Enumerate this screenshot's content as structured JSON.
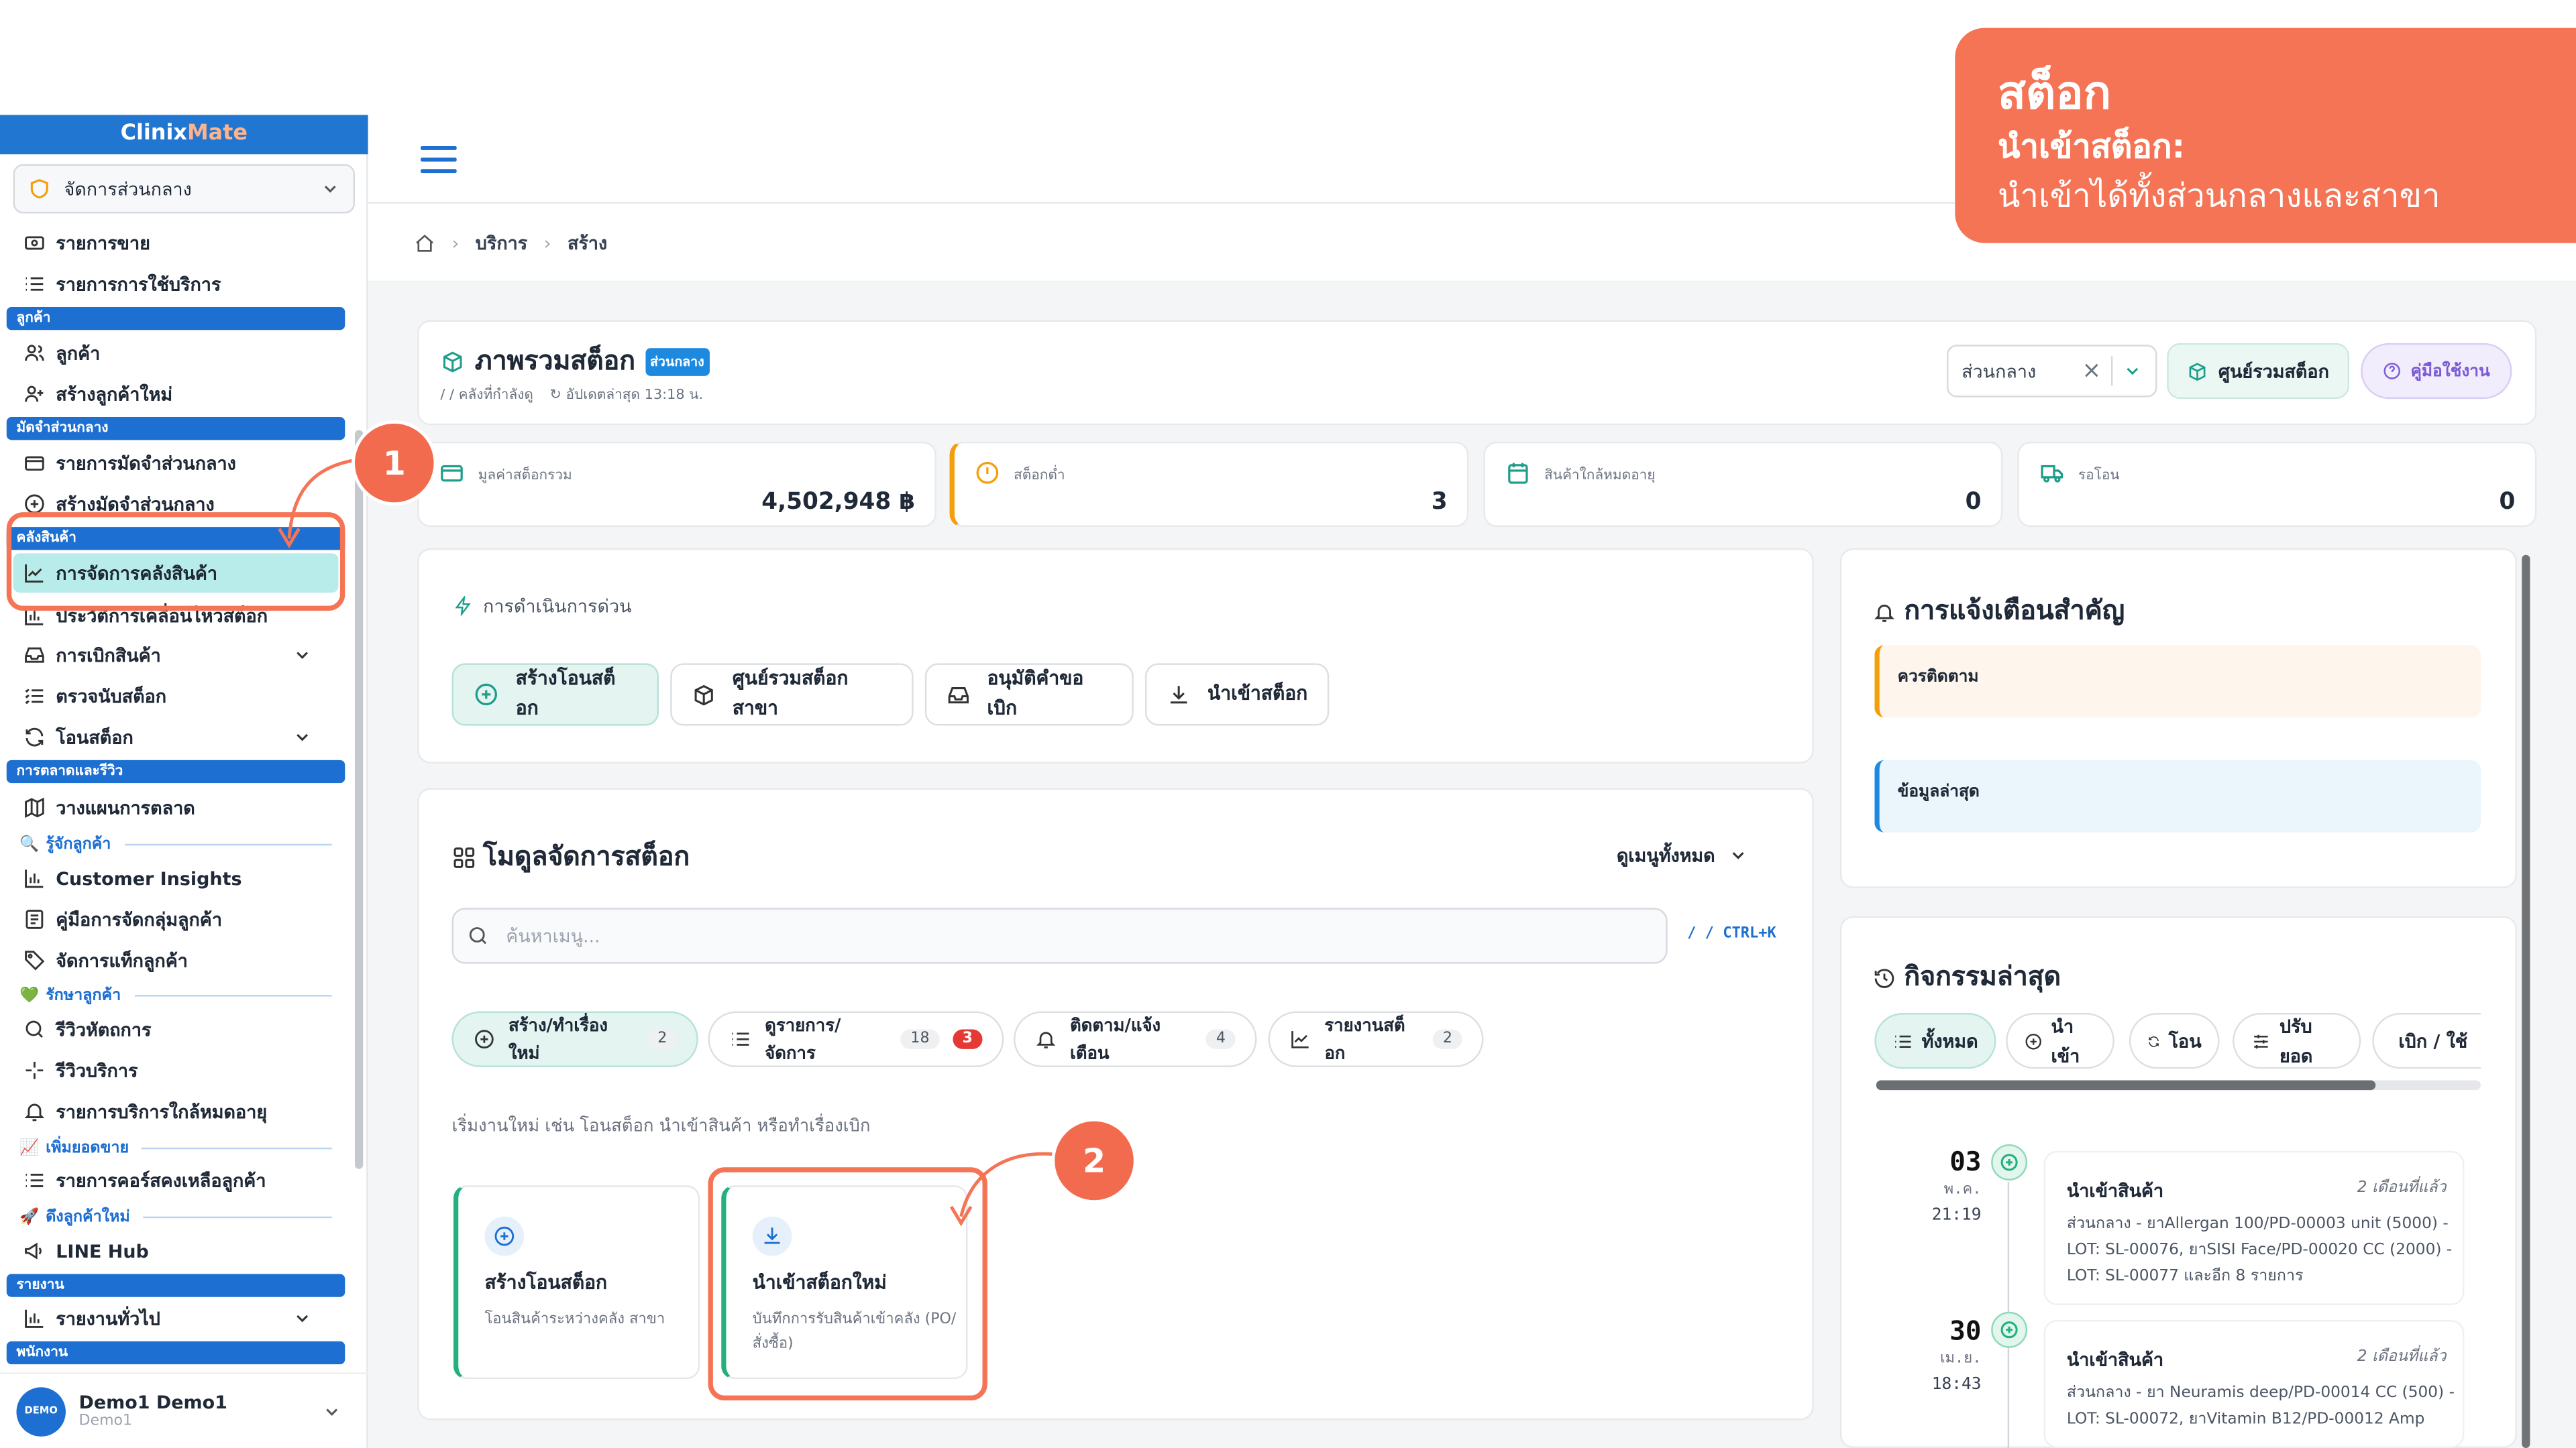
{
  "banner": {
    "title": "สต็อก",
    "subtitle": "นำเข้าสต็อก:",
    "desc": "นำเข้าได้ทั้งส่วนกลางและสาขา"
  },
  "sidebar": {
    "brand_a": "Clinix",
    "brand_b": "Mate",
    "branch": "จัดการส่วนกลาง",
    "items": [
      {
        "label": "รายการขาย",
        "icon": "receipt-icon"
      },
      {
        "label": "รายการการใช้บริการ",
        "icon": "list-icon"
      },
      {
        "label": "ลูกค้า",
        "icon": "users-icon"
      },
      {
        "label": "สร้างลูกค้าใหม่",
        "icon": "user-plus-icon"
      },
      {
        "label": "รายการมัดจำส่วนกลาง",
        "icon": "wallet-icon"
      },
      {
        "label": "สร้างมัดจำส่วนกลาง",
        "icon": "plus-circle-icon"
      },
      {
        "label": "การจัดการคลังสินค้า",
        "icon": "chart-line-icon"
      },
      {
        "label": "ประวัติการเคลื่อนไหวสต็อก",
        "icon": "bar-chart-icon"
      },
      {
        "label": "การเบิกสินค้า",
        "icon": "inbox-icon"
      },
      {
        "label": "ตรวจนับสต็อก",
        "icon": "list-check-icon"
      },
      {
        "label": "โอนสต็อก",
        "icon": "refresh-icon"
      },
      {
        "label": "วางแผนการตลาด",
        "icon": "map-icon"
      },
      {
        "label": "Customer Insights",
        "icon": "bar-chart-icon"
      },
      {
        "label": "คู่มือการจัดกลุ่มลูกค้า",
        "icon": "book-icon"
      },
      {
        "label": "จัดการแท็กลูกค้า",
        "icon": "tag-icon"
      },
      {
        "label": "รีวิวหัตถการ",
        "icon": "search-icon"
      },
      {
        "label": "รีวิวบริการ",
        "icon": "sparkle-icon"
      },
      {
        "label": "รายการบริการใกล้หมดอายุ",
        "icon": "bell-icon"
      },
      {
        "label": "รายการคอร์สคงเหลือลูกค้า",
        "icon": "list-icon"
      },
      {
        "label": "LINE Hub",
        "icon": "megaphone-icon"
      },
      {
        "label": "รายงานทั่วไป",
        "icon": "bar-chart-icon"
      }
    ],
    "sections": [
      "ลูกค้า",
      "มัดจำส่วนกลาง",
      "คลังสินค้า",
      "การตลาดและรีวิว",
      "รายงาน",
      "พนักงาน"
    ],
    "subsections": [
      "รู้จักลูกค้า",
      "รักษาลูกค้า",
      "เพิ่มยอดขาย",
      "ดึงลูกค้าใหม่"
    ],
    "user": {
      "avatar": "DEMO",
      "name": "Demo1 Demo1",
      "sub": "Demo1"
    }
  },
  "breadcrumb": [
    "บริการ",
    "สร้าง"
  ],
  "overview": {
    "title": "ภาพรวมสต็อก",
    "badge": "ส่วนกลาง",
    "sub1": "/ / คลังที่กำลังดู",
    "sub2": "อัปเดตล่าสุด 13:18 น.",
    "branch_select": "ส่วนกลาง",
    "center_btn": "ศูนย์รวมสต็อก",
    "guide_btn": "คู่มือใช้งาน"
  },
  "stats": [
    {
      "label": "มูลค่าสต็อกรวม",
      "value": "4,502,948 ฿"
    },
    {
      "label": "สต็อกต่ำ",
      "value": "3"
    },
    {
      "label": "สินค้าใกล้หมดอายุ",
      "value": "0"
    },
    {
      "label": "รอโอน",
      "value": "0"
    }
  ],
  "quick": {
    "title": "การดำเนินการด่วน",
    "buttons": [
      "สร้างโอนสต็อก",
      "ศูนย์รวมสต็อกสาขา",
      "อนุมัติคำขอเบิก",
      "นำเข้าสต็อก"
    ]
  },
  "module": {
    "title": "โมดูลจัดการสต็อก",
    "view_all": "ดูเมนูทั้งหมด",
    "search_placeholder": "ค้นหาเมนู...",
    "shortcut": "/ / CTRL+K",
    "tabs": [
      {
        "label": "สร้าง/ทำเรื่องใหม่",
        "count": "2"
      },
      {
        "label": "ดูรายการ/จัดการ",
        "count": "18",
        "alert": "3"
      },
      {
        "label": "ติดตาม/แจ้งเตือน",
        "count": "4"
      },
      {
        "label": "รายงานสต็อก",
        "count": "2"
      }
    ],
    "hint": "เริ่มงานใหม่ เช่น โอนสต็อก นำเข้าสินค้า หรือทำเรื่องเบิก",
    "tiles": [
      {
        "title": "สร้างโอนสต็อก",
        "desc": "โอนสินค้าระหว่างคลัง สาขา"
      },
      {
        "title": "นำเข้าสต็อกใหม่",
        "desc": "บันทึกการรับสินค้าเข้าคลัง (PO/สั่งซื้อ)"
      }
    ]
  },
  "alerts": {
    "title": "การแจ้งเตือนสำคัญ",
    "items": [
      "ควรติดตาม",
      "ข้อมูลล่าสุด"
    ]
  },
  "activity": {
    "title": "กิจกรรมล่าสุด",
    "tabs": [
      "ทั้งหมด",
      "นำเข้า",
      "โอน",
      "ปรับยอด",
      "เบิก / ใช้"
    ],
    "events": [
      {
        "day": "03",
        "month": "พ.ค.",
        "time": "21:19",
        "title": "นำเข้าสินค้า",
        "ago": "2 เดือนที่แล้ว",
        "body": "ส่วนกลาง - ยาAllergan 100/PD-00003 unit (5000) - LOT: SL-00076, ยาSISI Face/PD-00020 CC (2000) - LOT: SL-00077 และอีก 8 รายการ"
      },
      {
        "day": "30",
        "month": "เม.ย.",
        "time": "18:43",
        "title": "นำเข้าสินค้า",
        "ago": "2 เดือนที่แล้ว",
        "body": "ส่วนกลาง - ยา Neuramis deep/PD-00014 CC (500) - LOT: SL-00072, ยาVitamin B12/PD-00012 Amp"
      }
    ]
  },
  "annotations": [
    "1",
    "2"
  ],
  "colors": {
    "primary": "#1d6fd1",
    "accent": "#f47455",
    "success": "#22b07d"
  }
}
